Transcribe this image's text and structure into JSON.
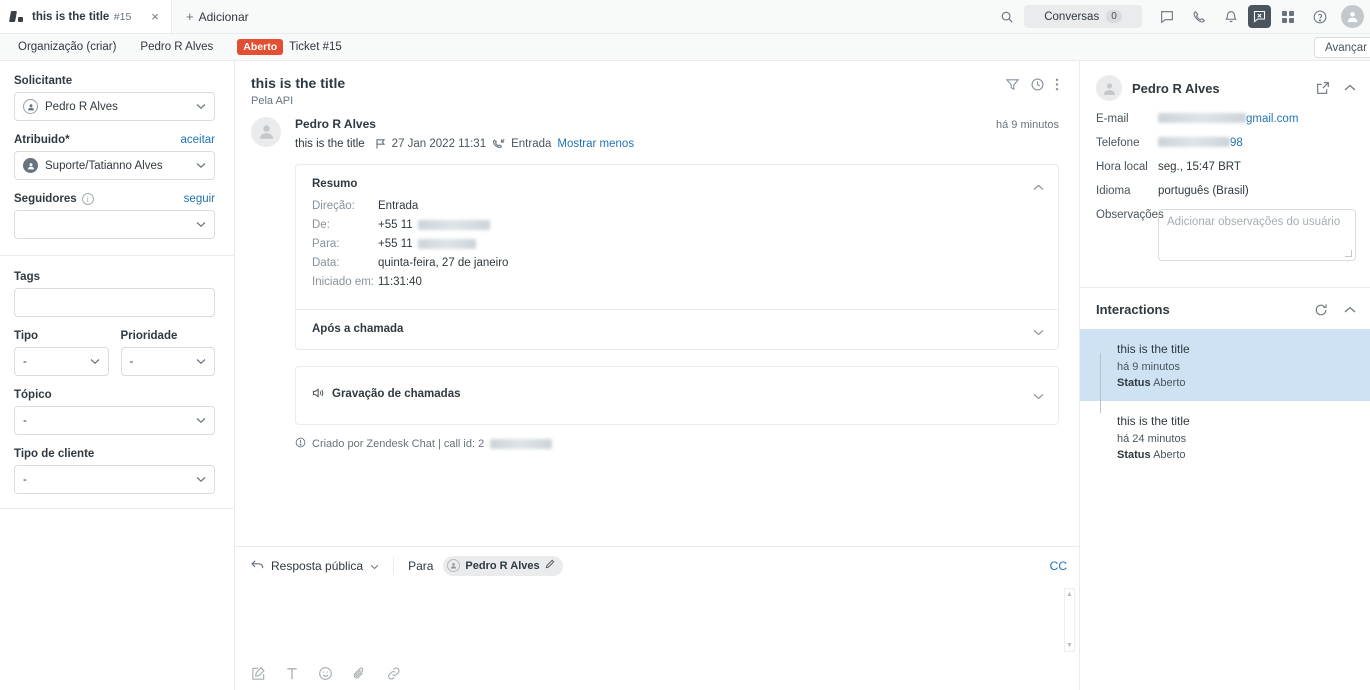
{
  "tab": {
    "title": "this is the title",
    "number": "#15",
    "close": "×",
    "add_label": "Adicionar",
    "add_plus": "+"
  },
  "topbar": {
    "conversations_label": "Conversas",
    "conversations_count": "0"
  },
  "breadcrumb": {
    "organization": "Organização (criar)",
    "requester": "Pedro R Alves",
    "status_badge": "Aberto",
    "ticket": "Ticket #15",
    "advance_label": "Avançar"
  },
  "sidebar": {
    "requester_label": "Solicitante",
    "requester_value": "Pedro R Alves",
    "assignee_label": "Atribuido*",
    "assignee_action": "aceitar",
    "assignee_value": "Suporte/Tatianno Alves",
    "followers_label": "Seguidores",
    "followers_action": "seguir",
    "followers_value": "",
    "tags_label": "Tags",
    "tags_value": "",
    "type_label": "Tipo",
    "type_value": "-",
    "priority_label": "Prioridade",
    "priority_value": "-",
    "topic_label": "Tópico",
    "topic_value": "-",
    "customer_type_label": "Tipo de cliente",
    "customer_type_value": "-"
  },
  "main": {
    "title": "this is the title",
    "subtitle": "Pela API",
    "message": {
      "author": "Pedro R Alves",
      "time": "há 9 minutos",
      "text": "this is the title",
      "date": "27 Jan 2022 11:31",
      "direction": "Entrada",
      "toggle": "Mostrar menos"
    },
    "summary": {
      "heading": "Resumo",
      "rows": [
        {
          "key": "Direção:",
          "value": "Entrada",
          "redacted": false
        },
        {
          "key": "De:",
          "value": "+55 11",
          "redacted": true
        },
        {
          "key": "Para:",
          "value": "+55 11",
          "redacted": true
        },
        {
          "key": "Data:",
          "value": "quinta-feira, 27 de janeiro",
          "redacted": false
        },
        {
          "key": "Iniciado em:",
          "value": "11:31:40",
          "redacted": false
        }
      ]
    },
    "after_call": "Após a chamada",
    "recording": "Gravação de chamadas",
    "footer_note": "Criado por Zendesk Chat  |  call id: 2"
  },
  "composer": {
    "reply_type": "Resposta pública",
    "to_label": "Para",
    "recipient": "Pedro R Alves",
    "cc_label": "CC",
    "placeholder": ""
  },
  "right": {
    "user": {
      "name": "Pedro R Alves",
      "email_label": "E-mail",
      "email_value": "gmail.com",
      "phone_label": "Telefone",
      "phone_value": "98",
      "localtime_label": "Hora local",
      "localtime_value": "seg., 15:47 BRT",
      "language_label": "Idioma",
      "language_value": "português (Brasil)",
      "notes_label": "Observações",
      "notes_placeholder": "Adicionar observações do usuário"
    },
    "interactions": {
      "title": "Interactions",
      "items": [
        {
          "title": "this is the title",
          "time": "há 9 minutos",
          "status_label": "Status",
          "status_value": "Aberto"
        },
        {
          "title": "this is the title",
          "time": "há 24 minutos",
          "status_label": "Status",
          "status_value": "Aberto"
        }
      ]
    }
  },
  "colors": {
    "status_open": "#e34f32",
    "link": "#1f73b7",
    "selected_row": "#cfe2f3",
    "interaction_dot": "#cc3340",
    "active_icon_bg": "#49545c"
  }
}
